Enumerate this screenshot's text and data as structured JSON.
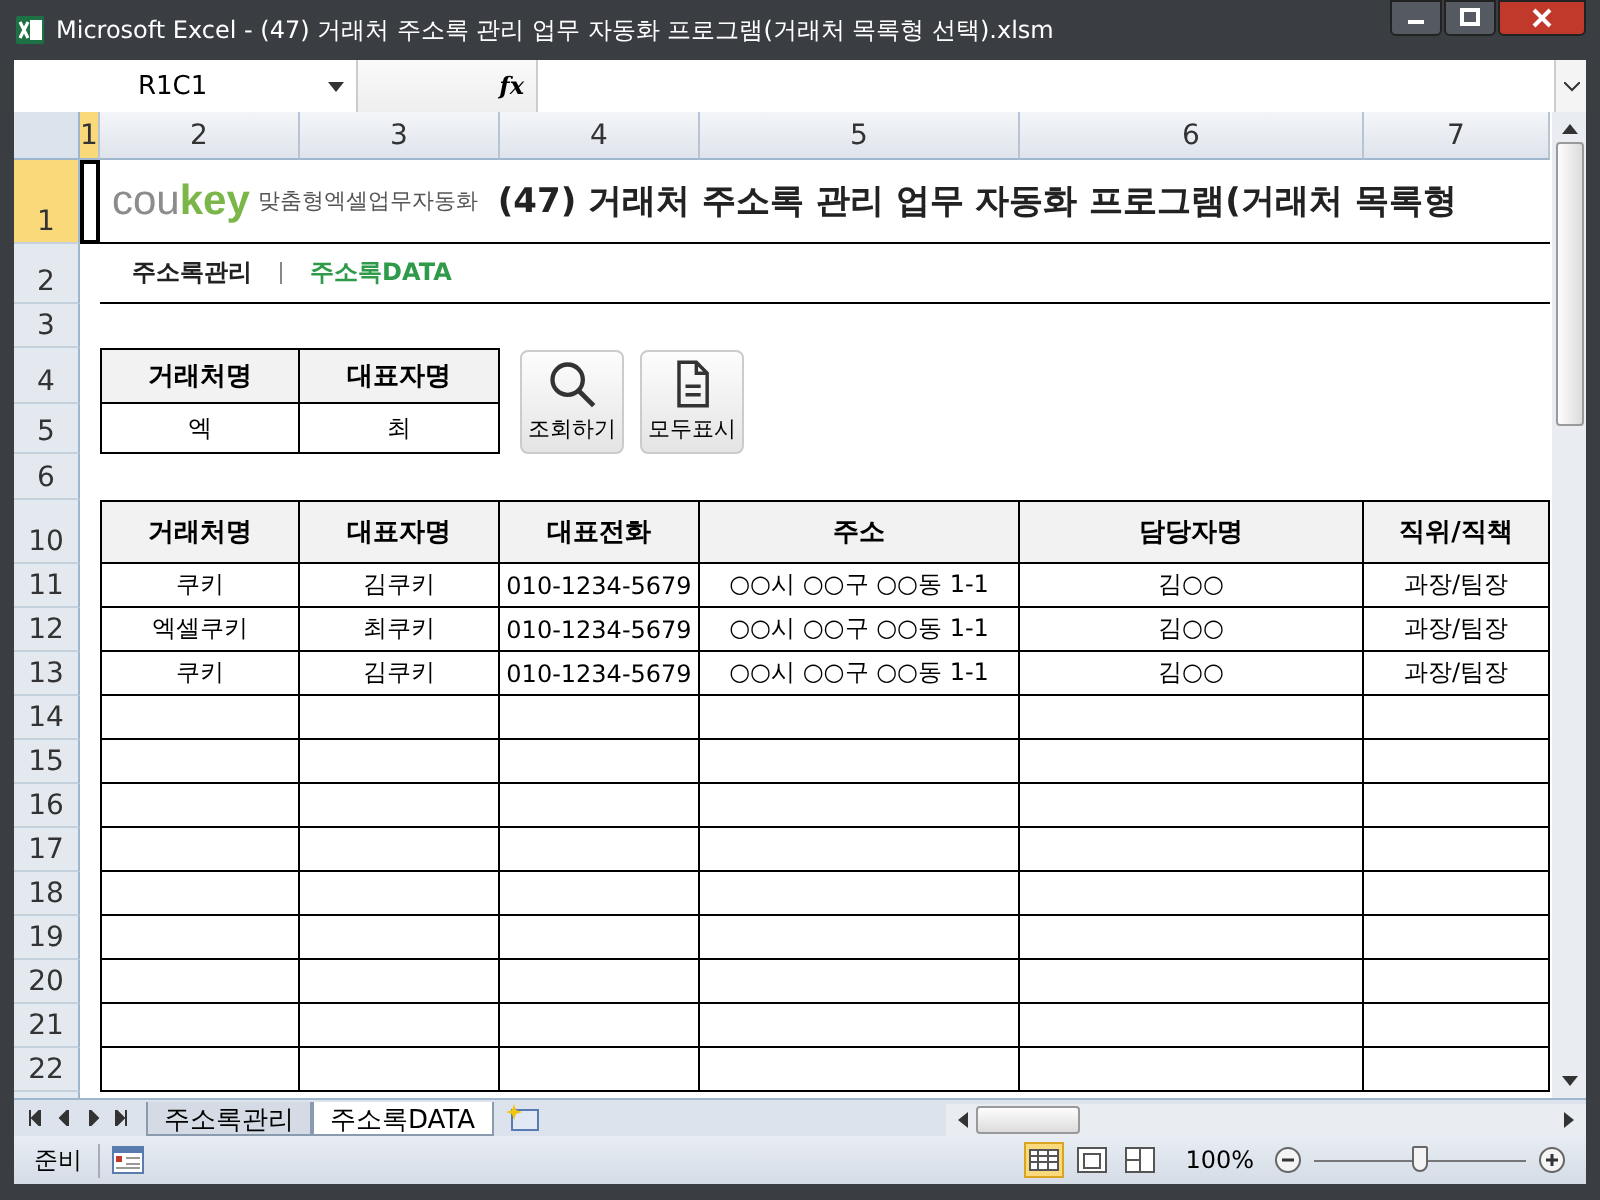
{
  "window": {
    "title": "Microsoft Excel - (47) 거래처 주소록 관리 업무 자동화 프로그램(거래처 목록형 선택).xlsm"
  },
  "formula_bar": {
    "name_box": "R1C1",
    "fx": "fx"
  },
  "column_headers": [
    {
      "label": "1",
      "selected": true
    },
    {
      "label": "2",
      "selected": false
    },
    {
      "label": "3",
      "selected": false
    },
    {
      "label": "4",
      "selected": false
    },
    {
      "label": "5",
      "selected": false
    },
    {
      "label": "6",
      "selected": false
    },
    {
      "label": "7",
      "selected": false
    }
  ],
  "row_headers": [
    {
      "label": "1",
      "selected": true
    },
    {
      "label": "2",
      "selected": false
    },
    {
      "label": "3",
      "selected": false
    },
    {
      "label": "4",
      "selected": false
    },
    {
      "label": "5",
      "selected": false
    },
    {
      "label": "6",
      "selected": false
    },
    {
      "label": "10",
      "selected": false
    },
    {
      "label": "11",
      "selected": false
    },
    {
      "label": "12",
      "selected": false
    },
    {
      "label": "13",
      "selected": false
    },
    {
      "label": "14",
      "selected": false
    },
    {
      "label": "15",
      "selected": false
    },
    {
      "label": "16",
      "selected": false
    },
    {
      "label": "17",
      "selected": false
    },
    {
      "label": "18",
      "selected": false
    },
    {
      "label": "19",
      "selected": false
    },
    {
      "label": "20",
      "selected": false
    },
    {
      "label": "21",
      "selected": false
    },
    {
      "label": "22",
      "selected": false
    }
  ],
  "banner": {
    "logo_gray": "cou",
    "logo_green": "key",
    "tagline": "맞춤형엑셀업무자동화",
    "title": "(47) 거래처 주소록 관리 업무 자동화 프로그램(거래처 목록형"
  },
  "nav": [
    {
      "label": "주소록관리",
      "selected": false
    },
    {
      "label": "주소록DATA",
      "selected": true
    }
  ],
  "search": {
    "columns": [
      "거래처명",
      "대표자명"
    ],
    "values": [
      "엑",
      "최"
    ]
  },
  "buttons": [
    {
      "label": "조회하기",
      "kind": "search"
    },
    {
      "label": "모두표시",
      "kind": "document"
    }
  ],
  "table": {
    "columns": [
      "거래처명",
      "대표자명",
      "대표전화",
      "주소",
      "담당자명",
      "직위/직책"
    ],
    "rows": [
      [
        "쿠키",
        "김쿠키",
        "010-1234-5679",
        "○○시 ○○구 ○○동 1-1",
        "김○○",
        "과장/팀장"
      ],
      [
        "엑셀쿠키",
        "최쿠키",
        "010-1234-5679",
        "○○시 ○○구 ○○동 1-1",
        "김○○",
        "과장/팀장"
      ],
      [
        "쿠키",
        "김쿠키",
        "010-1234-5679",
        "○○시 ○○구 ○○동 1-1",
        "김○○",
        "과장/팀장"
      ]
    ]
  },
  "sheet_tabs": [
    {
      "label": "주소록관리",
      "selected": false
    },
    {
      "label": "주소록DATA",
      "selected": true
    }
  ],
  "status_bar": {
    "status": "준비",
    "zoom": "100%",
    "zoom_slider": {
      "level": 0.5
    }
  }
}
